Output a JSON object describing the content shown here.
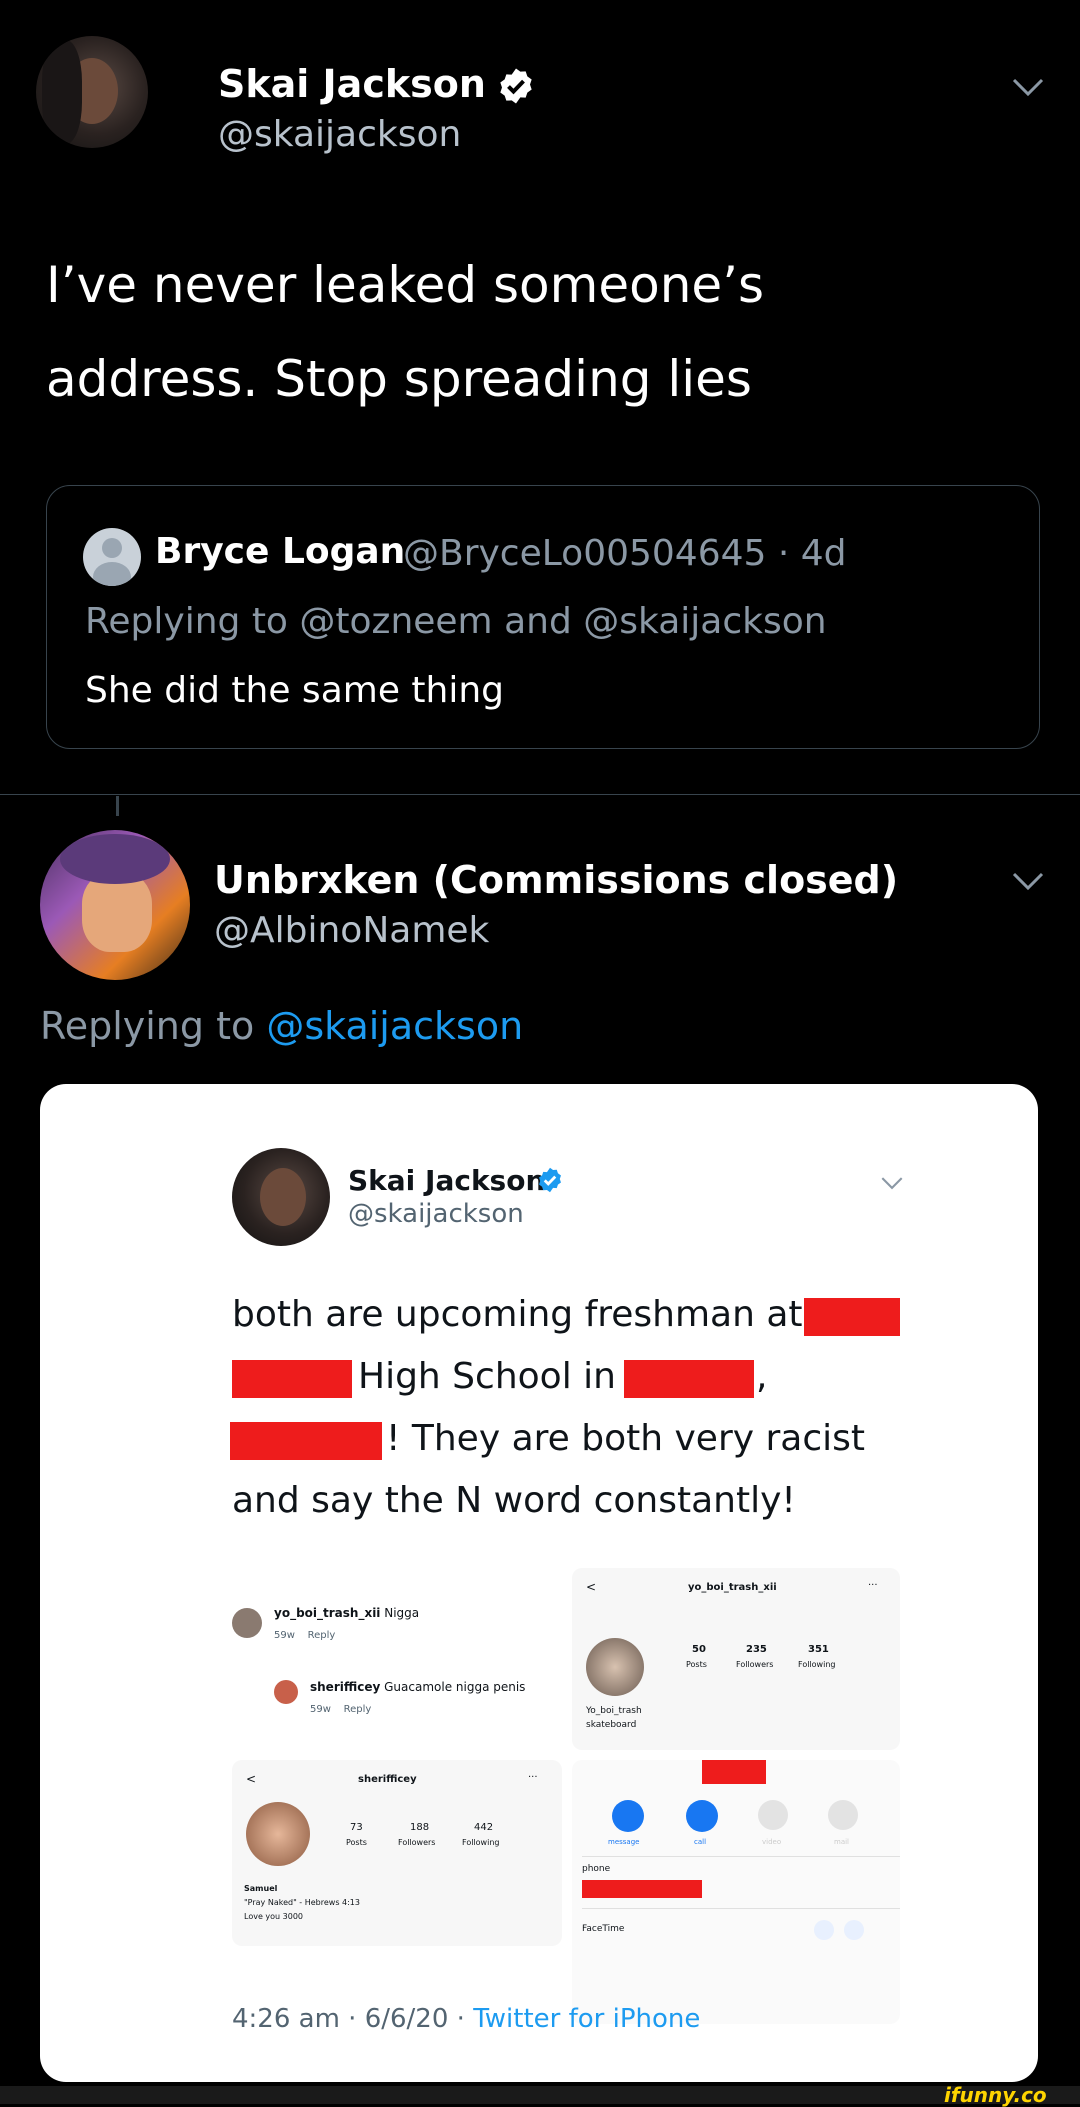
{
  "tweet": {
    "name": "Skai Jackson",
    "handle": "@skaijackson",
    "text_line1": "I’ve never leaked someone’s",
    "text_line2": "address. Stop spreading lies",
    "quoted": {
      "name": "Bryce Logan",
      "handle": "@BryceLo00504645 · 4d",
      "replying_prefix": "Replying to ",
      "replying_users": "@tozneem and @skaijackson",
      "text": "She did the same thing"
    }
  },
  "reply": {
    "name": "Unbrxken (Commissions closed)",
    "handle": "@AlbinoNamek",
    "replying_prefix": "Replying to ",
    "replying_user": "@skaijackson",
    "image": {
      "name": "Skai Jackson",
      "handle": "@skaijackson",
      "line1": "both are upcoming freshman at",
      "line2": "High School in",
      "line2_end": ",",
      "line3": "! They are both very racist",
      "line4": "and say the N word constantly!",
      "comment1_user": "yo_boi_trash_xii",
      "comment1_text": " Nigga",
      "comment1_meta": "59w    Reply",
      "comment2_user": "sherifficey",
      "comment2_text": " Guacamole nigga penis",
      "comment2_meta": "59w    Reply",
      "profile1": {
        "back": "<",
        "username": "yo_boi_trash_xii",
        "more": "···",
        "posts": "50",
        "posts_label": "Posts",
        "followers": "235",
        "followers_label": "Followers",
        "following": "351",
        "following_label": "Following",
        "bio1": "Yo_boi_trash",
        "bio2": "skateboard"
      },
      "profile2": {
        "back": "<",
        "username": "sherifficey",
        "more": "···",
        "posts": "73",
        "posts_label": "Posts",
        "followers": "188",
        "followers_label": "Followers",
        "following": "442",
        "following_label": "Following",
        "bio1": "Samuel",
        "bio2": "\"Pray Naked\" - Hebrews 4:13",
        "bio3": "Love you 3000"
      },
      "contact": {
        "message": "message",
        "call": "call",
        "video": "video",
        "mail": "mail",
        "phone_label": "phone",
        "facetime_label": "FaceTime"
      },
      "footer_time": "4:26 am · 6/6/20 · ",
      "footer_app": "Twitter for iPhone"
    }
  },
  "watermark": "ifunny.co",
  "colors": {
    "accent": "#1d9bf0",
    "redaction": "#ee1c1c"
  }
}
